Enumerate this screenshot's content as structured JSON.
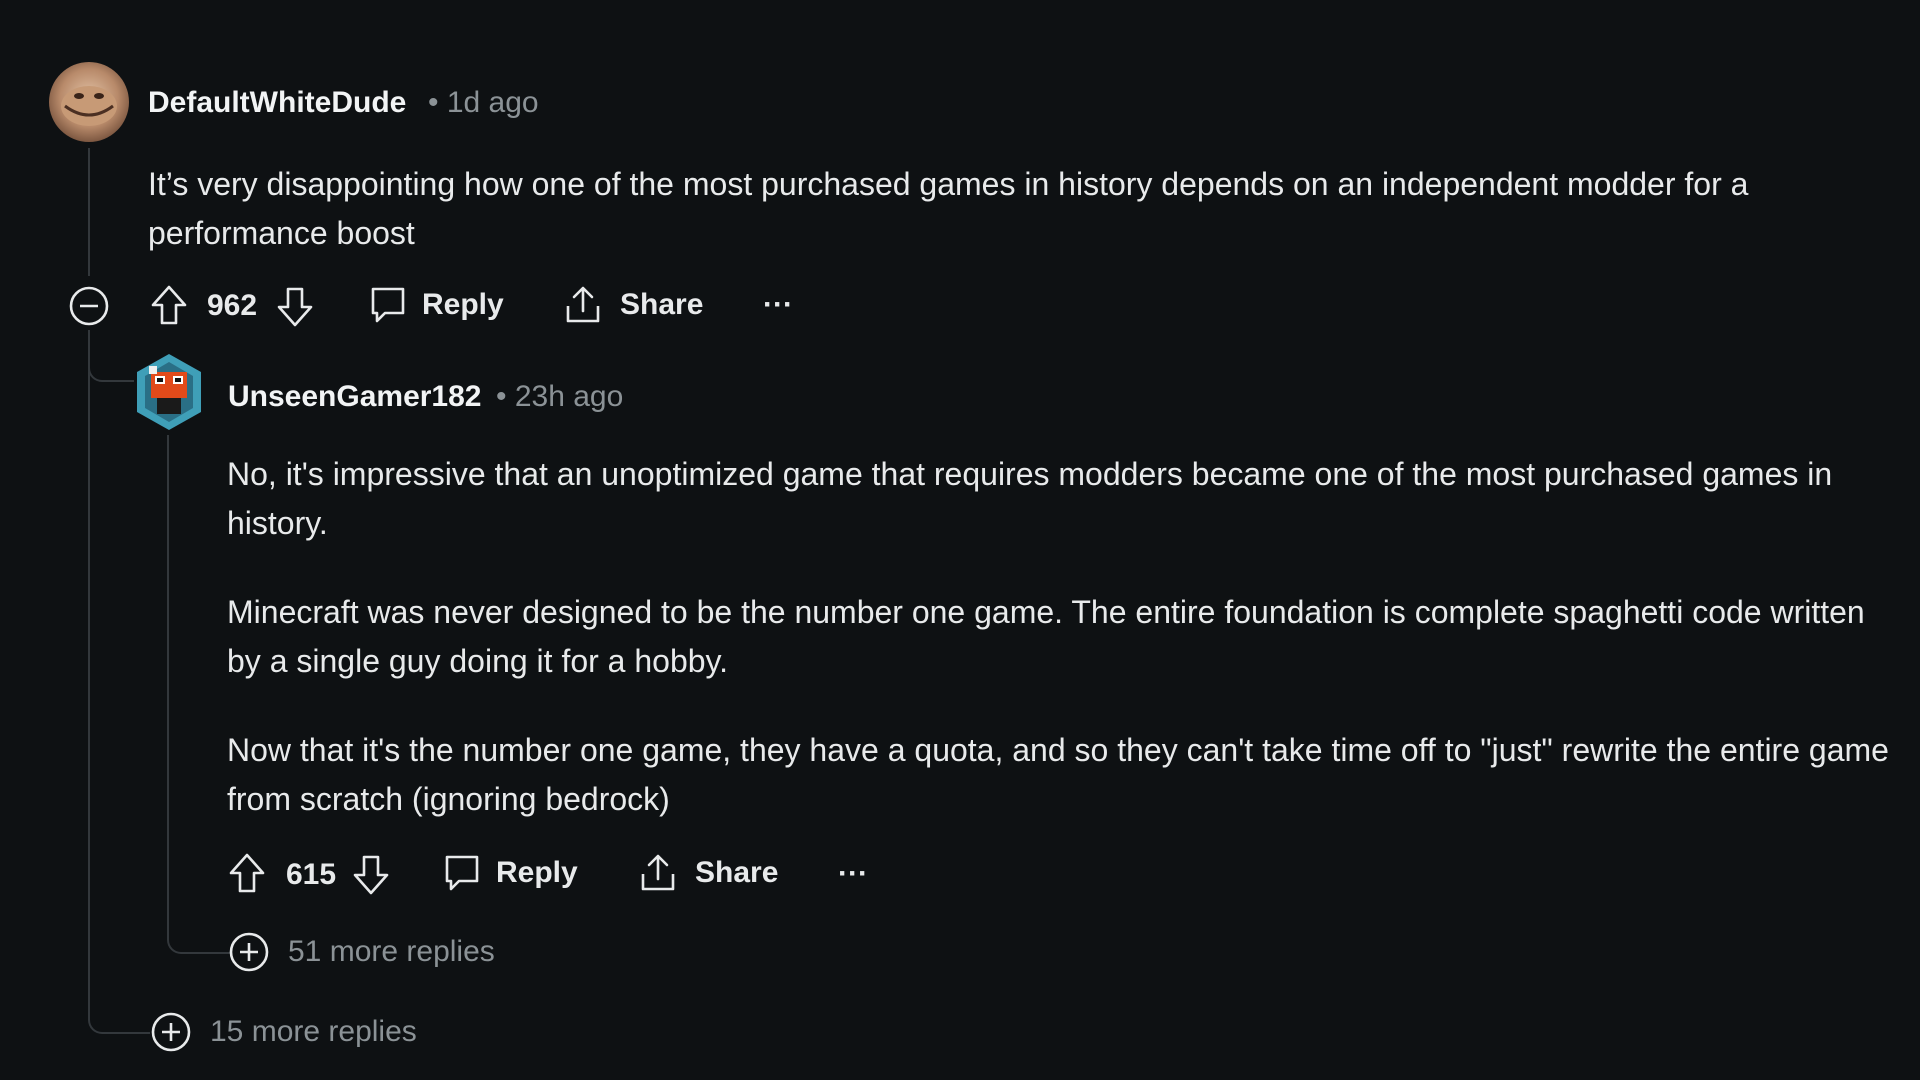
{
  "comments": [
    {
      "username": "DefaultWhiteDude",
      "timestamp": "• 1d ago",
      "body": [
        "It’s very disappointing how one of the most purchased games in history depends on an independent modder for a performance boost"
      ],
      "score": "962",
      "reply_label": "Reply",
      "share_label": "Share",
      "more_label": "···",
      "more_replies": "15 more replies"
    },
    {
      "username": "UnseenGamer182",
      "timestamp": "• 23h ago",
      "body": [
        "No, it's impressive that an unoptimized game that requires modders became one of the most purchased games in history.",
        "Minecraft was never designed to be the number one game. The entire foundation is complete spaghetti code written by a single guy doing it for a hobby.",
        "Now that it's the number one game, they have a quota, and so they can't take time off to \"just\" rewrite the entire game from scratch (ignoring bedrock)"
      ],
      "score": "615",
      "reply_label": "Reply",
      "share_label": "Share",
      "more_label": "···",
      "more_replies": "51 more replies"
    }
  ],
  "icons": {
    "collapse": "minus-circle-icon",
    "upvote": "arrow-up-icon",
    "downvote": "arrow-down-icon",
    "reply": "comment-bubble-icon",
    "share": "share-icon",
    "expand": "plus-circle-icon"
  },
  "colors": {
    "background": "#0e1113",
    "text": "#e8eaeb",
    "muted": "#8b9296",
    "thread_line": "#33383c"
  }
}
